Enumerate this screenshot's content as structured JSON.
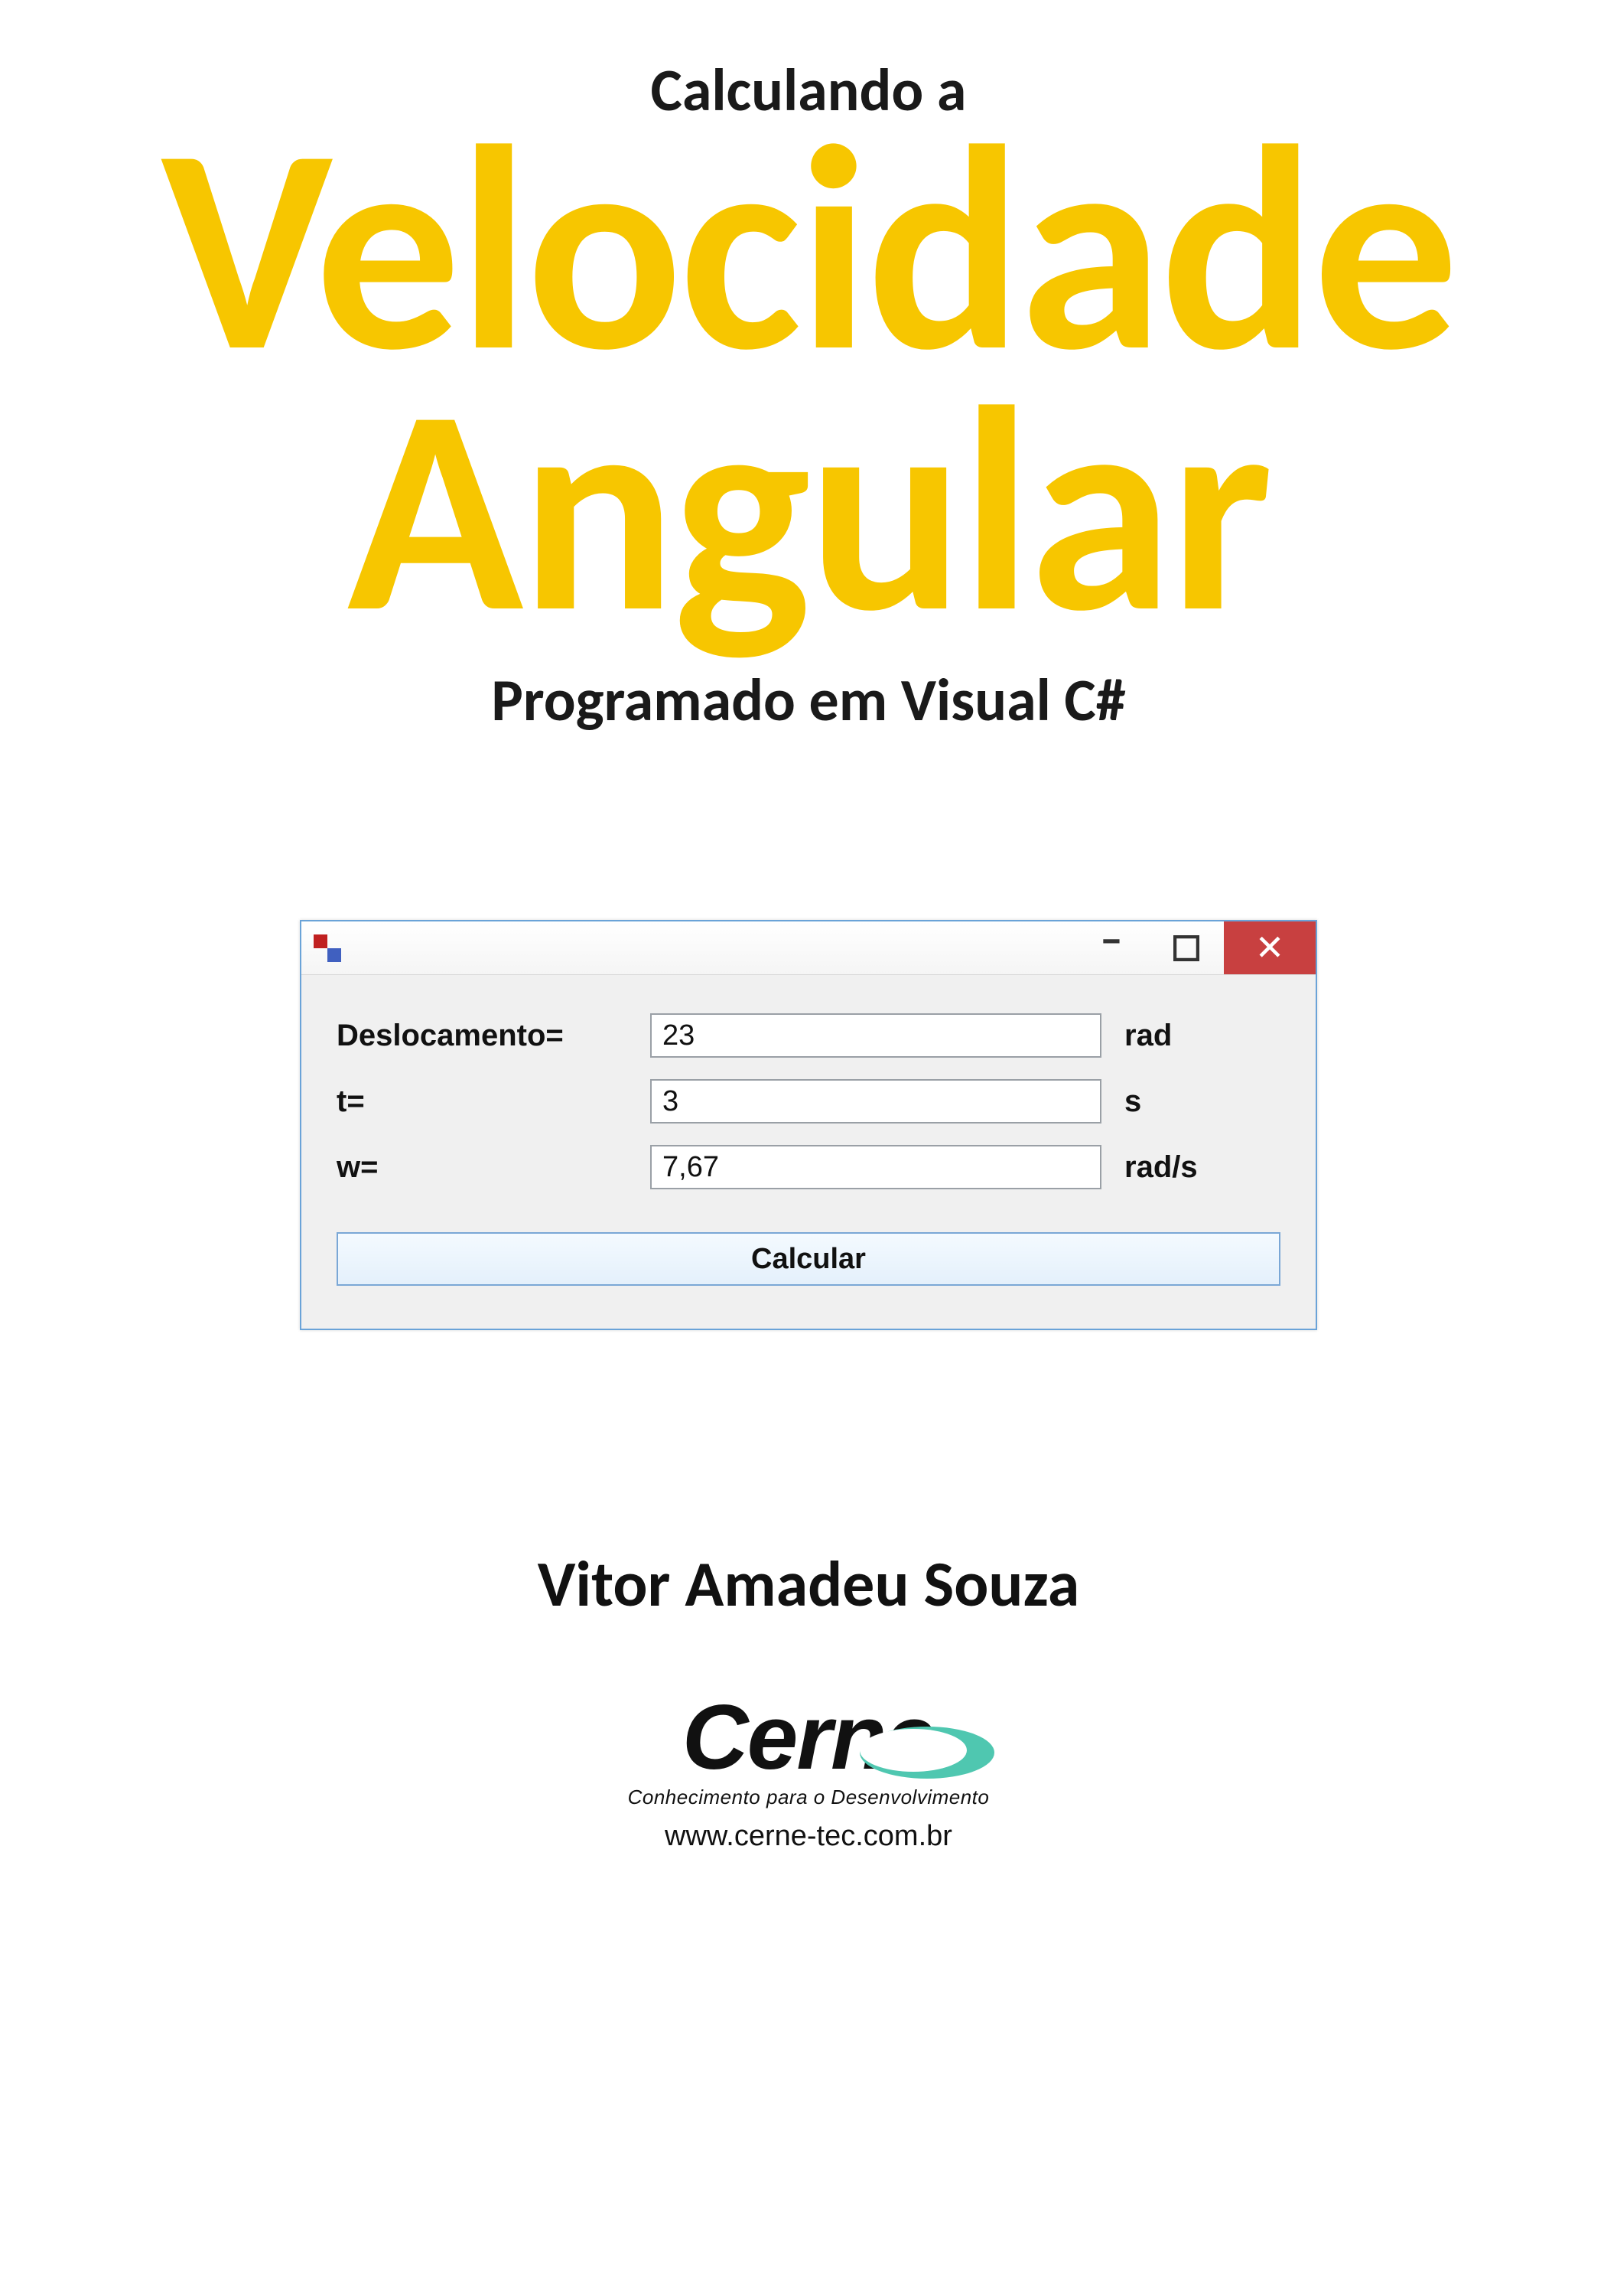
{
  "header": {
    "pre": "Calculando a",
    "main_line1": "Velocidade",
    "main_line2": "Angular",
    "sub": "Programado em Visual C#"
  },
  "window": {
    "title": "",
    "fields": [
      {
        "label": "Deslocamento=",
        "value": "23",
        "unit": "rad"
      },
      {
        "label": "t=",
        "value": "3",
        "unit": "s"
      },
      {
        "label": "w=",
        "value": "7,67",
        "unit": "rad/s"
      }
    ],
    "button_label": "Calcular"
  },
  "author": "Vitor Amadeu Souza",
  "logo": {
    "brand": "Cerne",
    "tagline": "Conhecimento para o Desenvolvimento",
    "url": "www.cerne-tec.com.br"
  },
  "colors": {
    "accent_yellow": "#f7c600",
    "win_border": "#6aa3d8",
    "close_red": "#c84040"
  }
}
